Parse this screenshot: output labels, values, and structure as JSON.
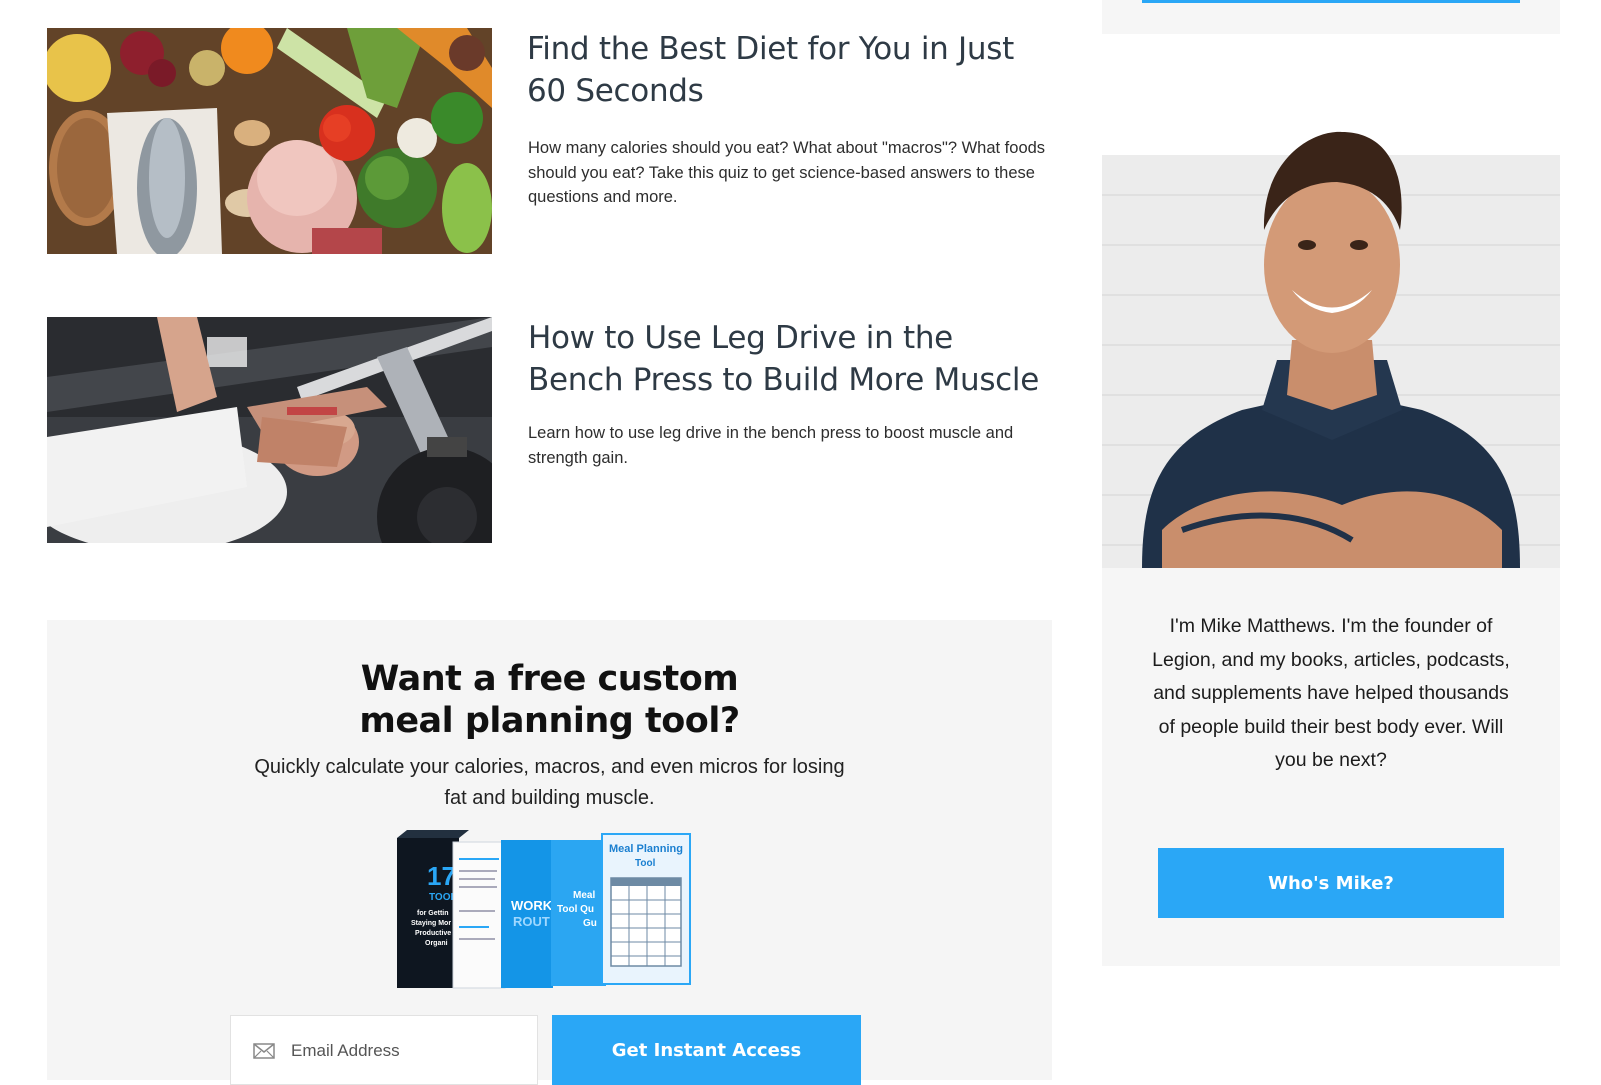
{
  "articles": [
    {
      "title": "Find the Best Diet for You in Just 60 Seconds",
      "excerpt": "How many calories should you eat? What about \"macros\"? What foods should you eat? Take this quiz to get science-based answers to these questions and more.",
      "image_alt": "assorted fresh food on a wooden table"
    },
    {
      "title": "How to Use Leg Drive in the Bench Press to Build More Muscle",
      "excerpt": "Learn how to use leg drive in the bench press to boost muscle and strength gain.",
      "image_alt": "man performing a bench press"
    }
  ],
  "optin": {
    "heading": "Want a free custom meal planning tool?",
    "subtext": "Quickly calculate your calories, macros, and even micros for losing fat and building muscle.",
    "email_placeholder": "Email Address",
    "button_label": "Get Instant Access",
    "books": {
      "book1_num": "17",
      "book1_line1": "TOOL",
      "book1_line2": "for Gettin",
      "book1_line3": "Staying Mor",
      "book1_line4": "Productive",
      "book1_line5": "Organi",
      "book3_line1": "WORK",
      "book3_line2": "ROUT",
      "book4_line1": "Meal",
      "book4_line2": "Tool Qu",
      "book4_line3": "Gu",
      "book5_title1": "Meal Planning",
      "book5_title2": "Tool"
    }
  },
  "sidebar": {
    "bio": "I'm Mike Matthews. I'm the founder of Legion, and my books, articles, podcasts, and supplements have helped thousands of people build their best body ever. Will you be next?",
    "button_label": "Who's Mike?"
  },
  "colors": {
    "accent": "#2aa7f6",
    "panel_bg": "#f5f5f5",
    "heading": "#2e3a45"
  },
  "icons": {
    "email": "envelope-icon"
  }
}
